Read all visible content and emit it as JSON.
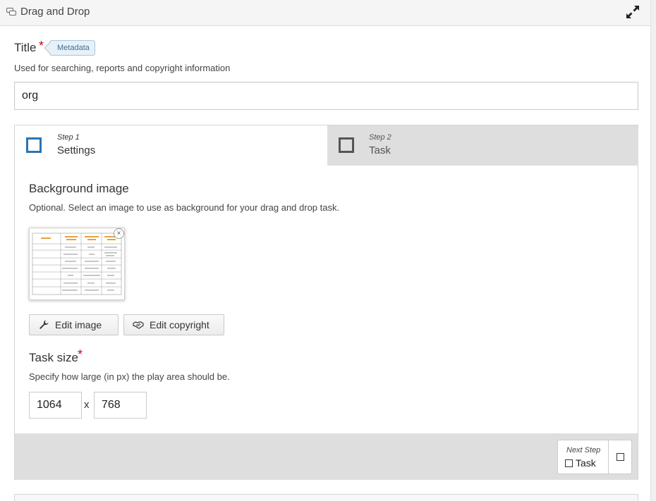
{
  "header": {
    "title": "Drag and Drop",
    "icon": "chat-bubbles-icon",
    "expand_icon": "expand-icon"
  },
  "title_field": {
    "label": "Title",
    "required_mark": "*",
    "metadata_label": "Metadata",
    "description": "Used for searching, reports and copyright information",
    "value": "org"
  },
  "wizard": {
    "steps": [
      {
        "number_label": "Step 1",
        "name": "Settings",
        "active": true
      },
      {
        "number_label": "Step 2",
        "name": "Task",
        "active": false
      }
    ],
    "background": {
      "heading": "Background image",
      "description": "Optional. Select an image to use as background for your drag and drop task.",
      "remove_glyph": "×",
      "edit_image_label": "Edit image",
      "edit_copyright_label": "Edit copyright"
    },
    "task_size": {
      "heading": "Task size",
      "required_mark": "*",
      "description": "Specify how large (in px) the play area should be.",
      "width": "1064",
      "separator": "x",
      "height": "768"
    },
    "footer": {
      "next_label": "Next Step",
      "next_target": "Task"
    }
  },
  "colors": {
    "accent": "#2b74b5",
    "required": "#d0021b",
    "tab_inactive": "#dedede"
  }
}
